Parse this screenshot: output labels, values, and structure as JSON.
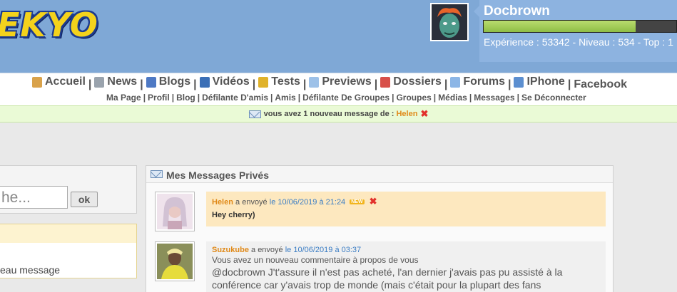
{
  "header": {
    "logo": "EKYO",
    "username": "Docbrown",
    "xp_progress": 0.79,
    "stats": "Expérience : 53342 - Niveau : 534 - Top : 1"
  },
  "nav": {
    "main": [
      {
        "label": "Accueil",
        "icon": "home-icon",
        "color": "#d9a24a"
      },
      {
        "label": "News",
        "icon": "news-icon",
        "color": "#9aa3ad"
      },
      {
        "label": "Blogs",
        "icon": "blog-icon",
        "color": "#4e79c4"
      },
      {
        "label": "Vidéos",
        "icon": "video-icon",
        "color": "#3b6fb6"
      },
      {
        "label": "Tests",
        "icon": "medal-icon",
        "color": "#e0b22a"
      },
      {
        "label": "Previews",
        "icon": "preview-icon",
        "color": "#9dc1e8"
      },
      {
        "label": "Dossiers",
        "icon": "folder-icon",
        "color": "#d8504a"
      },
      {
        "label": "Forums",
        "icon": "chat-icon",
        "color": "#8cb6e6"
      },
      {
        "label": "IPhone",
        "icon": "phone-icon",
        "color": "#5c8fd0"
      },
      {
        "label": "Facebook",
        "icon": "",
        "color": ""
      }
    ],
    "sub": [
      "Ma Page",
      "Profil",
      "Blog",
      "Défilante D'amis",
      "Amis",
      "Défilante De Groupes",
      "Groupes",
      "Médias",
      "Messages",
      "Se Déconnecter"
    ]
  },
  "notification": {
    "prefix": "vous avez",
    "count": "1",
    "suffix": "nouveau message de :",
    "user": "Helen"
  },
  "search": {
    "value": "he...",
    "button": "ok"
  },
  "left_box": {
    "text": "eau message"
  },
  "messages": {
    "title": "Mes Messages Privés",
    "items": [
      {
        "sender": "Helen",
        "action": "a envoyé",
        "date": "le 10/06/2019 à 21:24",
        "badge": "NEW",
        "body": "Hey cherry)",
        "avatar_color": "#e7cde0"
      },
      {
        "sender": "Suzukube",
        "action": "a envoyé",
        "date": "le 10/06/2019 à 03:37",
        "sub": "Vous avez un nouveau commentaire à propos de vous",
        "text": "@docbrown J't'assure il n'est pas acheté, l'an dernier j'avais pas pu assisté à la conférence car y'avais trop de monde (mais c'était pour la plupart des fans",
        "avatar_color": "#d8d24a"
      }
    ]
  },
  "colors": {
    "header_bg": "#7fa8d6",
    "accent_orange": "#e08a1a",
    "link_blue": "#3b7dc4",
    "notif_bg": "#eafad6",
    "close_red": "#e2302b"
  }
}
